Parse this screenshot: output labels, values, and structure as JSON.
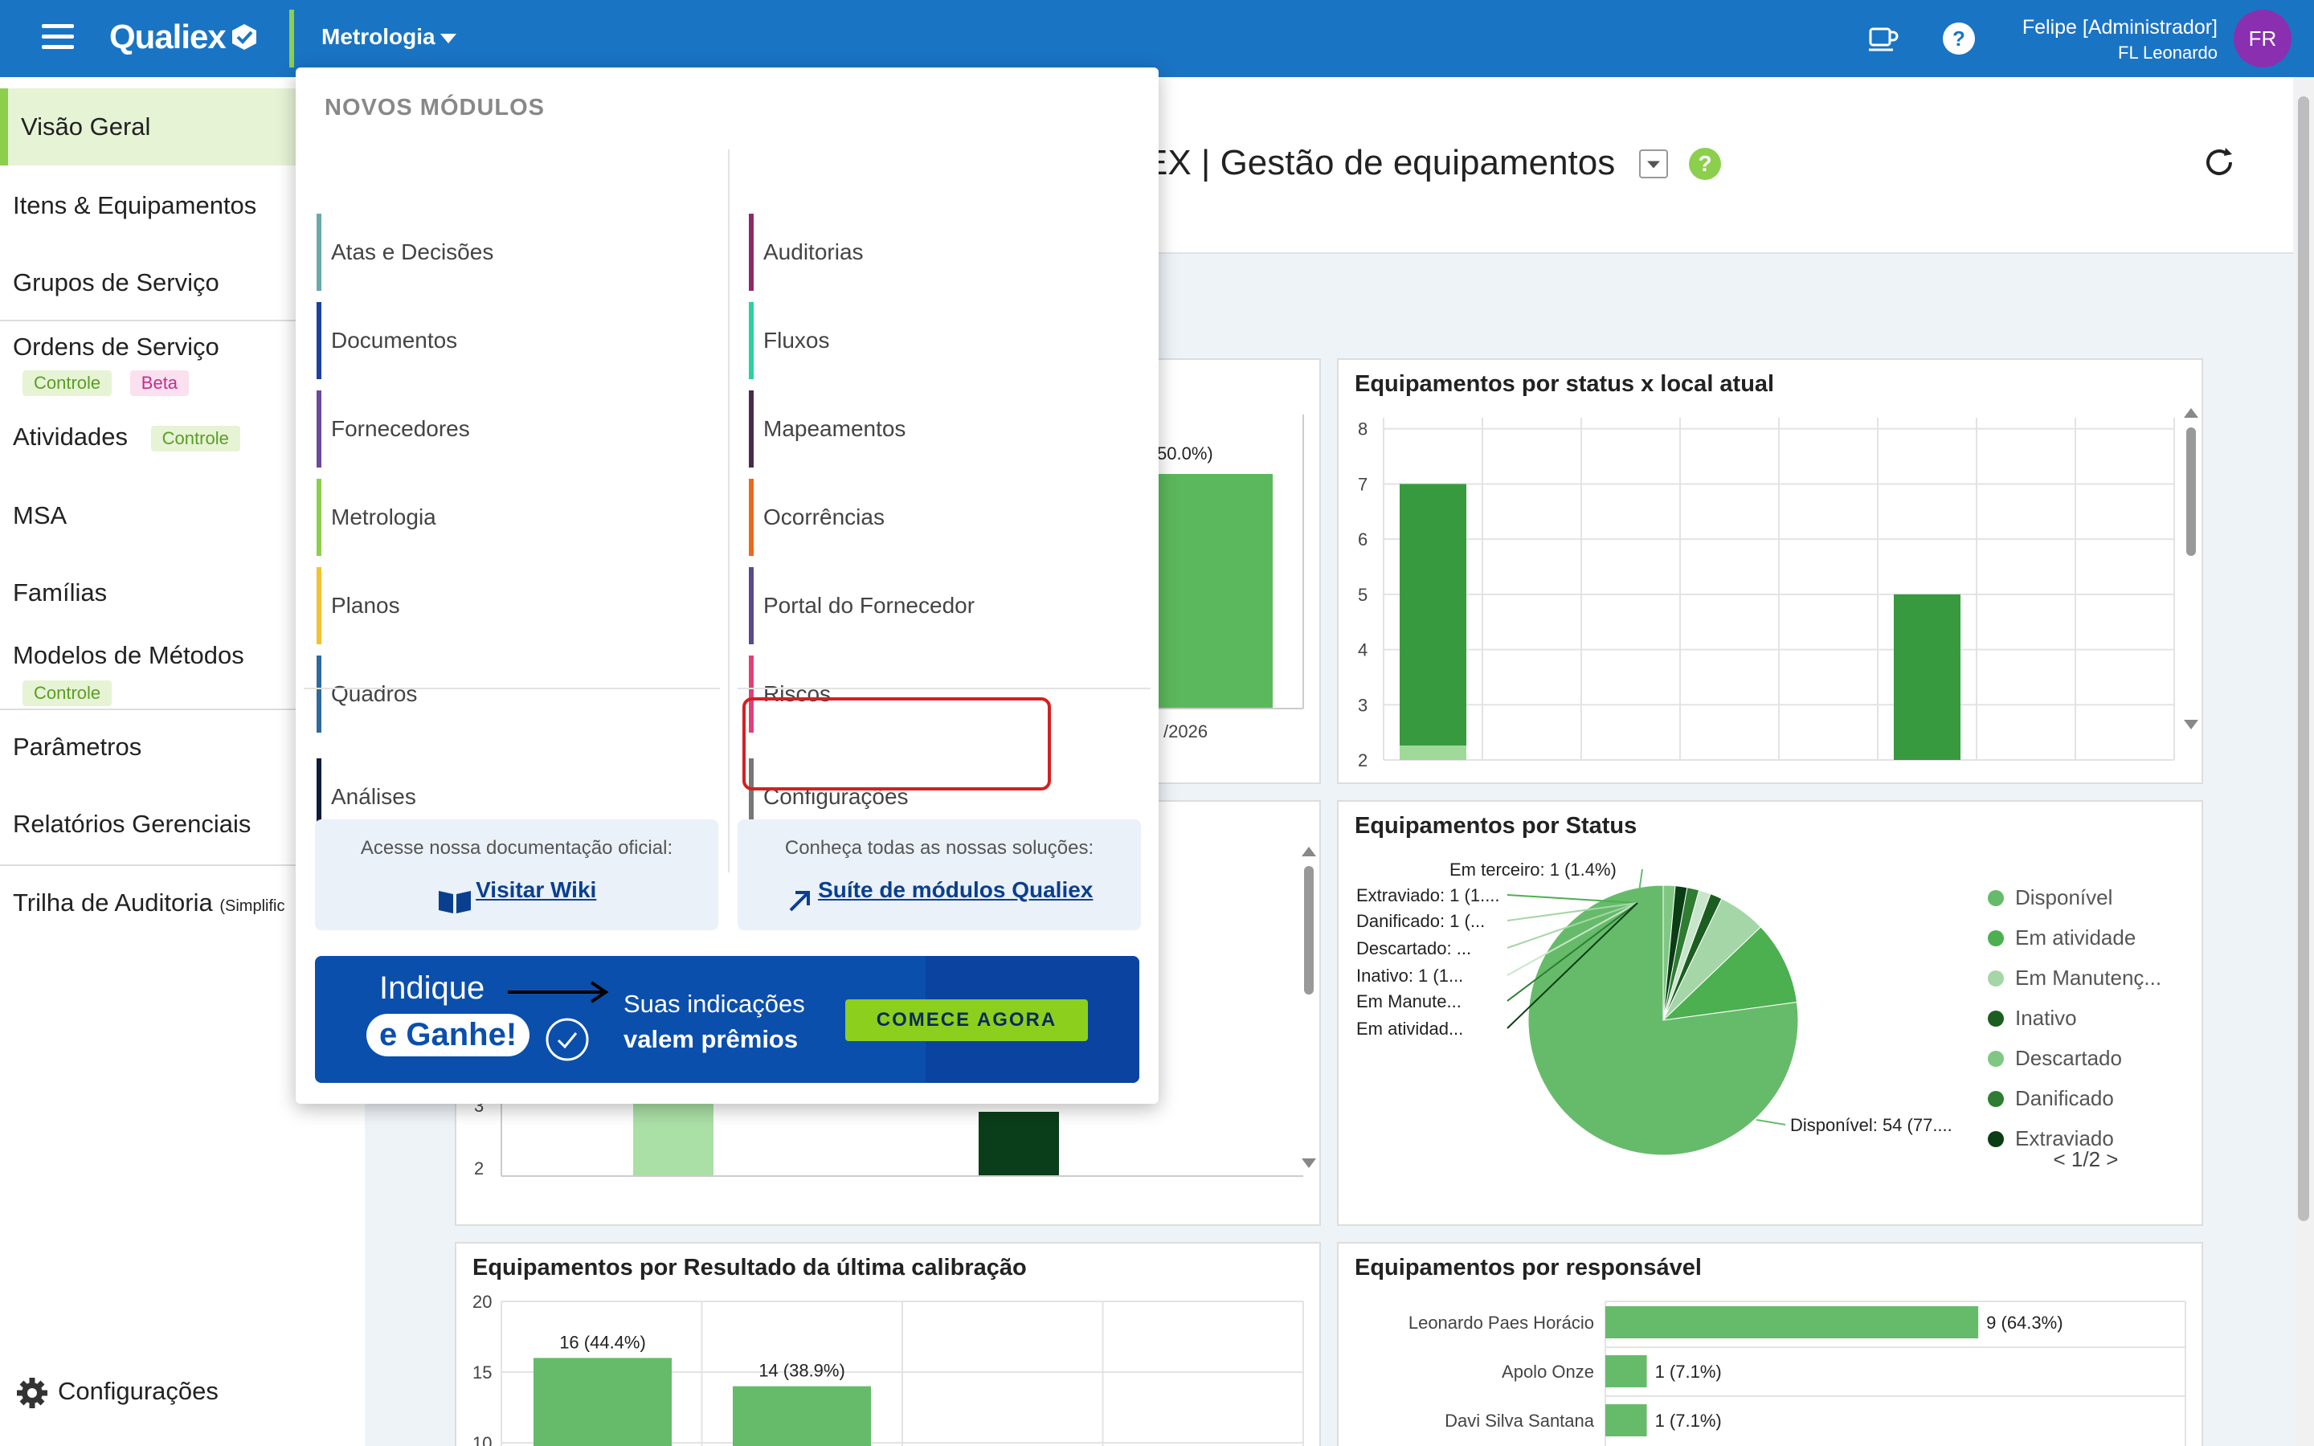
{
  "topbar": {
    "brand": "Qualiex",
    "module": "Metrologia",
    "user_name": "Felipe [Administrador]",
    "user_org": "FL Leonardo",
    "avatar_initials": "FR",
    "color": "#1a74c4"
  },
  "sidebar": {
    "items": [
      {
        "label": "Visão Geral"
      },
      {
        "label": "Itens & Equipamentos"
      },
      {
        "label": "Grupos de Serviço"
      },
      {
        "label": "Ordens de Serviço",
        "tags": [
          "Controle",
          "Beta"
        ]
      },
      {
        "label": "Atividades",
        "tags": [
          "Controle"
        ]
      },
      {
        "label": "MSA"
      },
      {
        "label": "Famílias"
      },
      {
        "label": "Modelos de Métodos",
        "tags": [
          "Controle"
        ]
      },
      {
        "label": "Parâmetros"
      },
      {
        "label": "Relatórios Gerenciais"
      },
      {
        "label": "Trilha de Auditoria",
        "suffix": "(Simplific"
      }
    ],
    "footer": "Configurações"
  },
  "header": {
    "title": "EX | Gestão de equipamentos"
  },
  "dropdown": {
    "heading": "NOVOS MÓDULOS",
    "left": [
      {
        "label": "Atas e Decisões",
        "color": "#6aa9a8"
      },
      {
        "label": "Documentos",
        "color": "#1e3f9e"
      },
      {
        "label": "Fornecedores",
        "color": "#6a4a9c"
      },
      {
        "label": "Metrologia",
        "color": "#8ccf4d"
      },
      {
        "label": "Planos",
        "color": "#f2c230"
      },
      {
        "label": "Quadros",
        "color": "#2e6a9e"
      },
      {
        "label": "Análises",
        "color": "#0e1c3a"
      }
    ],
    "right": [
      {
        "label": "Auditorias",
        "color": "#8a2a6a"
      },
      {
        "label": "Fluxos",
        "color": "#2ad1a0"
      },
      {
        "label": "Mapeamentos",
        "color": "#4a2a4a"
      },
      {
        "label": "Ocorrências",
        "color": "#e86a1a"
      },
      {
        "label": "Portal do Fornecedor",
        "color": "#5a4a8a"
      },
      {
        "label": "Riscos",
        "color": "#e0407a"
      },
      {
        "label": "Configurações",
        "color": "#777777"
      }
    ],
    "wiki_caption": "Acesse nossa documentação oficial:",
    "wiki_link": "Visitar Wiki",
    "suite_caption": "Conheça todas as nossas soluções:",
    "suite_link": "Suíte de módulos Qualiex",
    "banner": {
      "line1": "Indique",
      "line2": "e Ganhe!",
      "text1": "Suas indicações",
      "text2": "valem prêmios",
      "cta": "COMECE AGORA"
    }
  },
  "cards": {
    "status_local": {
      "title": "Equipamentos por status x local atual"
    },
    "status": {
      "title": "Equipamentos por Status"
    },
    "calibracao": {
      "title": "Equipamentos por Resultado da última calibração"
    },
    "responsavel": {
      "title": "Equipamentos por responsável"
    },
    "left_top_partial": {
      "label_pct": "50.0%)",
      "label_date": "/2026"
    }
  },
  "chart_data": [
    {
      "type": "bar",
      "title": "Equipamentos por status x local atual",
      "ylim": [
        2,
        8
      ],
      "yticks": [
        "8",
        "7",
        "6",
        "5",
        "4",
        "3",
        "2"
      ],
      "series": [
        {
          "values": [
            7,
            0,
            0,
            0,
            2,
            5,
            0,
            0
          ]
        }
      ]
    },
    {
      "type": "pie",
      "title": "Equipamentos por Status",
      "labels": [
        "Em terceiro: 1 (1.4%)",
        "Extraviado: 1 (1....",
        "Danificado: 1 (...",
        "Descartado: ...",
        "Inativo: 1 (1...",
        "Em Manute...",
        "Em atividad...",
        "Disponível: 54 (77...."
      ],
      "legend": [
        "Disponível",
        "Em atividade",
        "Em Manutenç...",
        "Inativo",
        "Descartado",
        "Danificado",
        "Extraviado"
      ],
      "legend_page": "1/2",
      "values": [
        54,
        7,
        4,
        1,
        1,
        1,
        1,
        1
      ]
    },
    {
      "type": "bar",
      "title": "Equipamentos por Resultado da última calibração",
      "yticks": [
        "20",
        "15",
        "10"
      ],
      "values": [
        16,
        14
      ],
      "labels": [
        "16 (44.4%)",
        "14 (38.9%)"
      ]
    },
    {
      "type": "bar",
      "title": "Equipamentos por responsável",
      "categories": [
        "Leonardo Paes Horácio",
        "Apolo Onze",
        "Davi Silva Santana"
      ],
      "values": [
        9,
        1,
        1
      ],
      "labels": [
        "9 (64.3%)",
        "1 (7.1%)",
        "1 (7.1%)"
      ]
    }
  ]
}
